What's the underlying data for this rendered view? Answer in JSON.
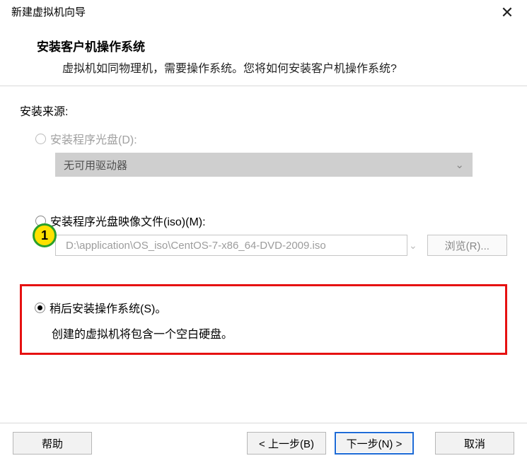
{
  "window": {
    "title": "新建虚拟机向导",
    "close_symbol": "✕"
  },
  "header": {
    "title": "安装客户机操作系统",
    "subtitle": "虚拟机如同物理机，需要操作系统。您将如何安装客户机操作系统?"
  },
  "source": {
    "label": "安装来源:"
  },
  "opt_disc": {
    "label": "安装程序光盘(D):",
    "dropdown_text": "无可用驱动器",
    "chevron": "⌄"
  },
  "opt_iso": {
    "label": "安装程序光盘映像文件(iso)(M):",
    "path": "D:\\application\\OS_iso\\CentOS-7-x86_64-DVD-2009.iso",
    "chevron": "⌄",
    "browse": "浏览(R)..."
  },
  "annotation": {
    "badge": "1"
  },
  "opt_later": {
    "label": "稍后安装操作系统(S)。",
    "desc": "创建的虚拟机将包含一个空白硬盘。"
  },
  "footer": {
    "help": "帮助",
    "back": "< 上一步(B)",
    "next": "下一步(N) >",
    "cancel": "取消"
  }
}
